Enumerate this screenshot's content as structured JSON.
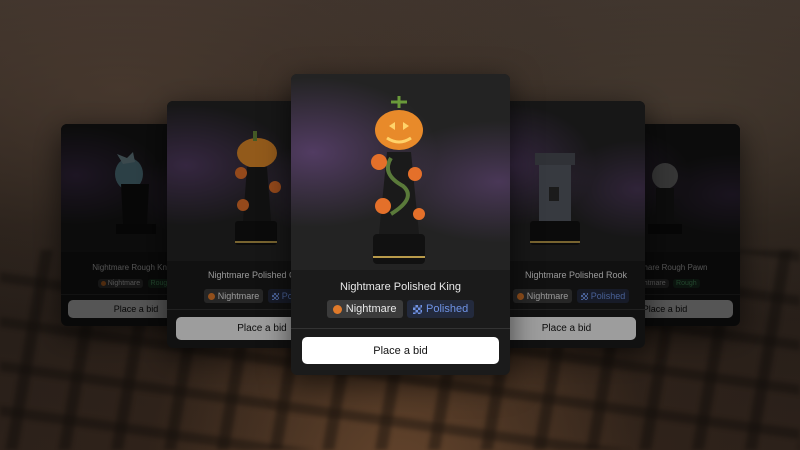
{
  "cards": [
    {
      "title": "Nightmare Rough Knight",
      "tag1": "Nightmare",
      "tag2": "Rough",
      "button": "Place a bid"
    },
    {
      "title": "Nightmare Polished Queen",
      "tag1": "Nightmare",
      "tag2": "Polished",
      "button": "Place a bid"
    },
    {
      "title": "Nightmare Polished King",
      "tag1": "Nightmare",
      "tag2": "Polished",
      "button": "Place a bid"
    },
    {
      "title": "Nightmare Polished Rook",
      "tag1": "Nightmare",
      "tag2": "Polished",
      "button": "Place a bid"
    },
    {
      "title": "Nightmare Rough Pawn",
      "tag1": "Nightmare",
      "tag2": "Rough",
      "button": "Place a bid"
    }
  ],
  "colors": {
    "pumpkin": "#e07a2a",
    "polished": "#6f93e6",
    "rough": "#3aa055",
    "card": "#1a1a1a"
  }
}
